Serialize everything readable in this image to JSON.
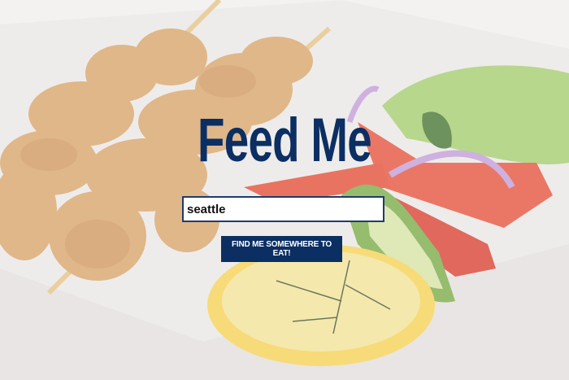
{
  "title": "Feed Me",
  "search": {
    "value": "seattle"
  },
  "button": {
    "label": "FIND ME SOMEWHERE TO EAT!"
  },
  "colors": {
    "brand": "#0b2f63"
  }
}
